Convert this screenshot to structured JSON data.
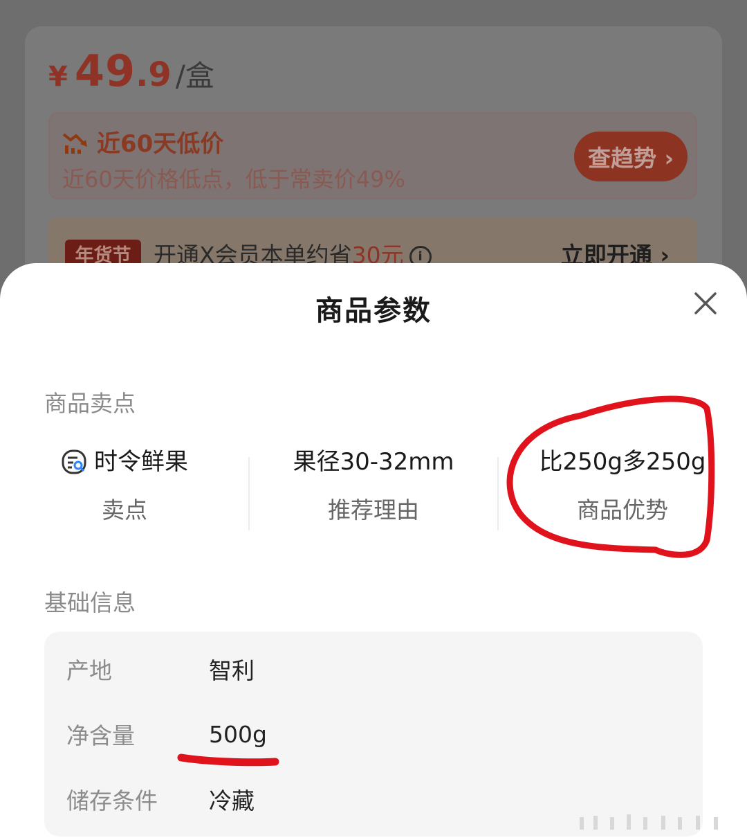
{
  "price": {
    "symbol": "¥",
    "integer": "49",
    "decimal": ".9",
    "unit": "/盒"
  },
  "low_price": {
    "title": "近60天低价",
    "subtitle": "近60天价格低点，低于常卖价49%",
    "trend_button": "查趋势 ›"
  },
  "member": {
    "badge": "年货节",
    "text_prefix": "开通X会员本单约省",
    "saving": "30元",
    "info_symbol": "i",
    "action": "立即开通 ›"
  },
  "sheet": {
    "title": "商品参数",
    "close_icon": "×"
  },
  "selling_points": {
    "label": "商品卖点",
    "items": [
      {
        "value": "时令鲜果",
        "caption": "卖点",
        "icon": "search-list-icon"
      },
      {
        "value": "果径30-32mm",
        "caption": "推荐理由"
      },
      {
        "value": "比250g多250g",
        "caption": "商品优势"
      }
    ]
  },
  "basic_info": {
    "label": "基础信息",
    "rows": [
      {
        "key": "产地",
        "value": "智利"
      },
      {
        "key": "净含量",
        "value": "500g"
      },
      {
        "key": "储存条件",
        "value": "冷藏"
      }
    ]
  },
  "colors": {
    "annotation_red": "#e0121b",
    "price_red": "#e23b1e",
    "overlay_gray": "#6e6e6e"
  }
}
